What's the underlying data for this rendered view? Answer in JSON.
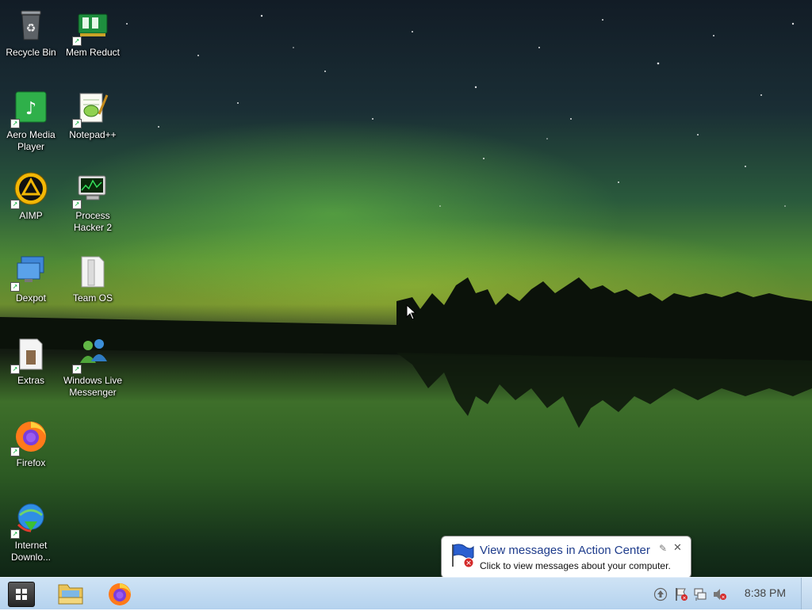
{
  "desktop": {
    "icons": [
      {
        "label": "Recycle Bin",
        "icon": "recycle-bin-icon"
      },
      {
        "label": "Mem Reduct",
        "icon": "memory-chip-icon"
      },
      {
        "label": "Aero Media Player",
        "icon": "music-note-icon"
      },
      {
        "label": "Notepad++",
        "icon": "notepad-icon"
      },
      {
        "label": "AIMP",
        "icon": "aimp-icon"
      },
      {
        "label": "Process Hacker 2",
        "icon": "process-hacker-icon"
      },
      {
        "label": "Dexpot",
        "icon": "monitors-icon"
      },
      {
        "label": "Team OS",
        "icon": "folder-icon"
      },
      {
        "label": "Extras",
        "icon": "folder-icon"
      },
      {
        "label": "Windows Live Messenger",
        "icon": "messenger-icon"
      },
      {
        "label": "Firefox",
        "icon": "firefox-icon"
      },
      {
        "label": "Internet Downlo...",
        "icon": "download-manager-icon"
      }
    ]
  },
  "notification": {
    "title": "View messages in Action Center",
    "message": "Click to view messages about your computer.",
    "close_glyph": "✕",
    "pin_glyph": "✎"
  },
  "taskbar": {
    "start_icon": "windows-logo-icon",
    "pinned": [
      {
        "name": "File Explorer",
        "icon": "folder-icon"
      },
      {
        "name": "Firefox",
        "icon": "firefox-icon"
      }
    ],
    "tray": [
      "upload-arrow-icon",
      "action-center-flag-icon",
      "network-icon",
      "volume-muted-icon"
    ],
    "clock": "8:38 PM"
  },
  "colors": {
    "taskbar": "#b4d2ee",
    "balloon_title": "#1e3c8c"
  }
}
